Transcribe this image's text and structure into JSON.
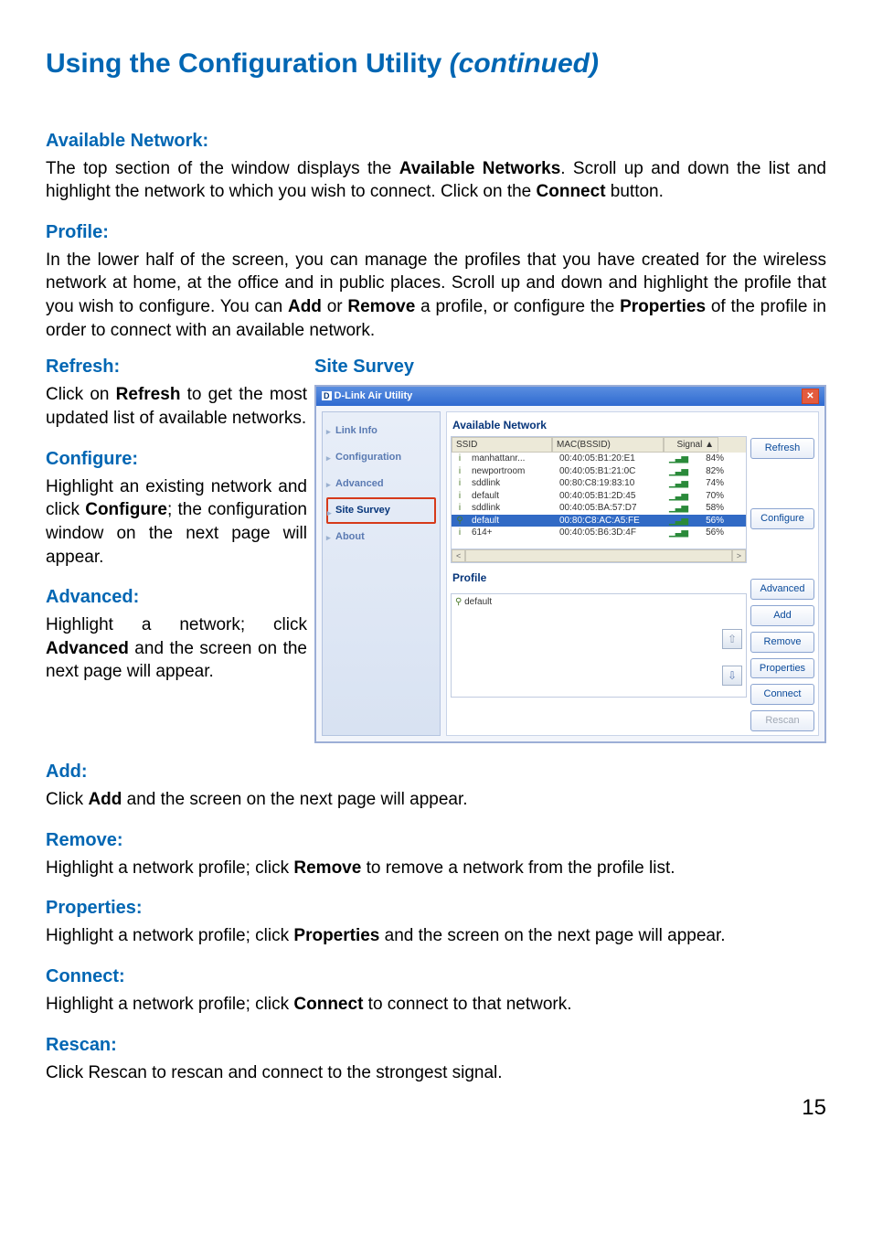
{
  "page_title_main": "Using the Configuration Utility ",
  "page_title_cont": "(continued)",
  "sec_available_head": "Available Network:",
  "sec_available_t1": "The top section of the window displays the ",
  "sec_available_b1": "Available Networks",
  "sec_available_t2": ". Scroll up and down the list and highlight the network to which you wish to connect. Click on the ",
  "sec_available_b2": "Connect",
  "sec_available_t3": " button.",
  "sec_profile_head": "Profile:",
  "sec_profile_t1": "In the lower half of the screen, you can manage the profiles that you have created for the wireless network at home, at the office and in public places. Scroll up and down and highlight the profile that you wish to configure. You can ",
  "sec_profile_b1": "Add",
  "sec_profile_t2": " or ",
  "sec_profile_b2": "Remove",
  "sec_profile_t3": " a profile, or configure the ",
  "sec_profile_b3": "Properties",
  "sec_profile_t4": " of the profile in order to connect with an available network.",
  "sec_refresh_head": "Refresh:",
  "sec_refresh_t1": "Click on ",
  "sec_refresh_b1": "Refresh",
  "sec_refresh_t2": " to get the most updated list of available networks.",
  "sec_configure_head": "Configure:",
  "sec_configure_t1": "Highlight an existing network and click ",
  "sec_configure_b1": "Configure",
  "sec_configure_t2": "; the configuration window on the next page will appear.",
  "sec_advanced_head": "Advanced:",
  "sec_advanced_t1": "Highlight a network; click ",
  "sec_advanced_b1": "Advanced",
  "sec_advanced_t2": " and the screen on the next page will appear.",
  "sec_add_head": "Add:",
  "sec_add_t1": "Click ",
  "sec_add_b1": "Add",
  "sec_add_t2": " and the screen on the next page will appear.",
  "sec_remove_head": "Remove:",
  "sec_remove_t1": "Highlight a network profile; click ",
  "sec_remove_b1": "Remove",
  "sec_remove_t2": " to remove a network from the profile list.",
  "sec_properties_head": "Properties:",
  "sec_properties_t1": "Highlight a network profile; click ",
  "sec_properties_b1": "Properties",
  "sec_properties_t2": " and the screen on the next page will appear.",
  "sec_connect_head": "Connect:",
  "sec_connect_t1": "Highlight a network profile; click ",
  "sec_connect_b1": "Connect",
  "sec_connect_t2": " to connect to that network.",
  "sec_rescan_head": "Rescan:",
  "sec_rescan_text": "Click Rescan to rescan and connect to the strongest signal.",
  "page_number": "15",
  "screenshot": {
    "title": "Site Survey",
    "window_title": "D-Link Air Utility",
    "close_x": "✕",
    "nav": {
      "link_info": "Link Info",
      "configuration": "Configuration",
      "advanced": "Advanced",
      "site_survey": "Site Survey",
      "about": "About"
    },
    "available_label": "Available Network",
    "cols": {
      "ssid": "SSID",
      "mac": "MAC(BSSID)",
      "sig": "Signal"
    },
    "sort_icon": "▲",
    "rows": [
      {
        "i": "i",
        "ssid": "manhattanr...",
        "mac": "00:40:05:B1:20:E1",
        "sig": "84%"
      },
      {
        "i": "i",
        "ssid": "newportroom",
        "mac": "00:40:05:B1:21:0C",
        "sig": "82%"
      },
      {
        "i": "i",
        "ssid": "sddlink",
        "mac": "00:80:C8:19:83:10",
        "sig": "74%"
      },
      {
        "i": "i",
        "ssid": "default",
        "mac": "00:40:05:B1:2D:45",
        "sig": "70%"
      },
      {
        "i": "i",
        "ssid": "sddlink",
        "mac": "00:40:05:BA:57:D7",
        "sig": "58%"
      },
      {
        "i": "⚲",
        "ssid": "default",
        "mac": "00:80:C8:AC:A5:FE",
        "sig": "56%",
        "sel": true
      },
      {
        "i": "i",
        "ssid": "614+",
        "mac": "00:40:05:B6:3D:4F",
        "sig": "56%"
      }
    ],
    "scroll_left": "<",
    "scroll_right": ">",
    "profile_label": "Profile",
    "profile_item": "default",
    "btns": {
      "refresh": "Refresh",
      "configure": "Configure",
      "advanced": "Advanced",
      "add": "Add",
      "remove": "Remove",
      "properties": "Properties",
      "connect": "Connect",
      "rescan": "Rescan"
    }
  }
}
